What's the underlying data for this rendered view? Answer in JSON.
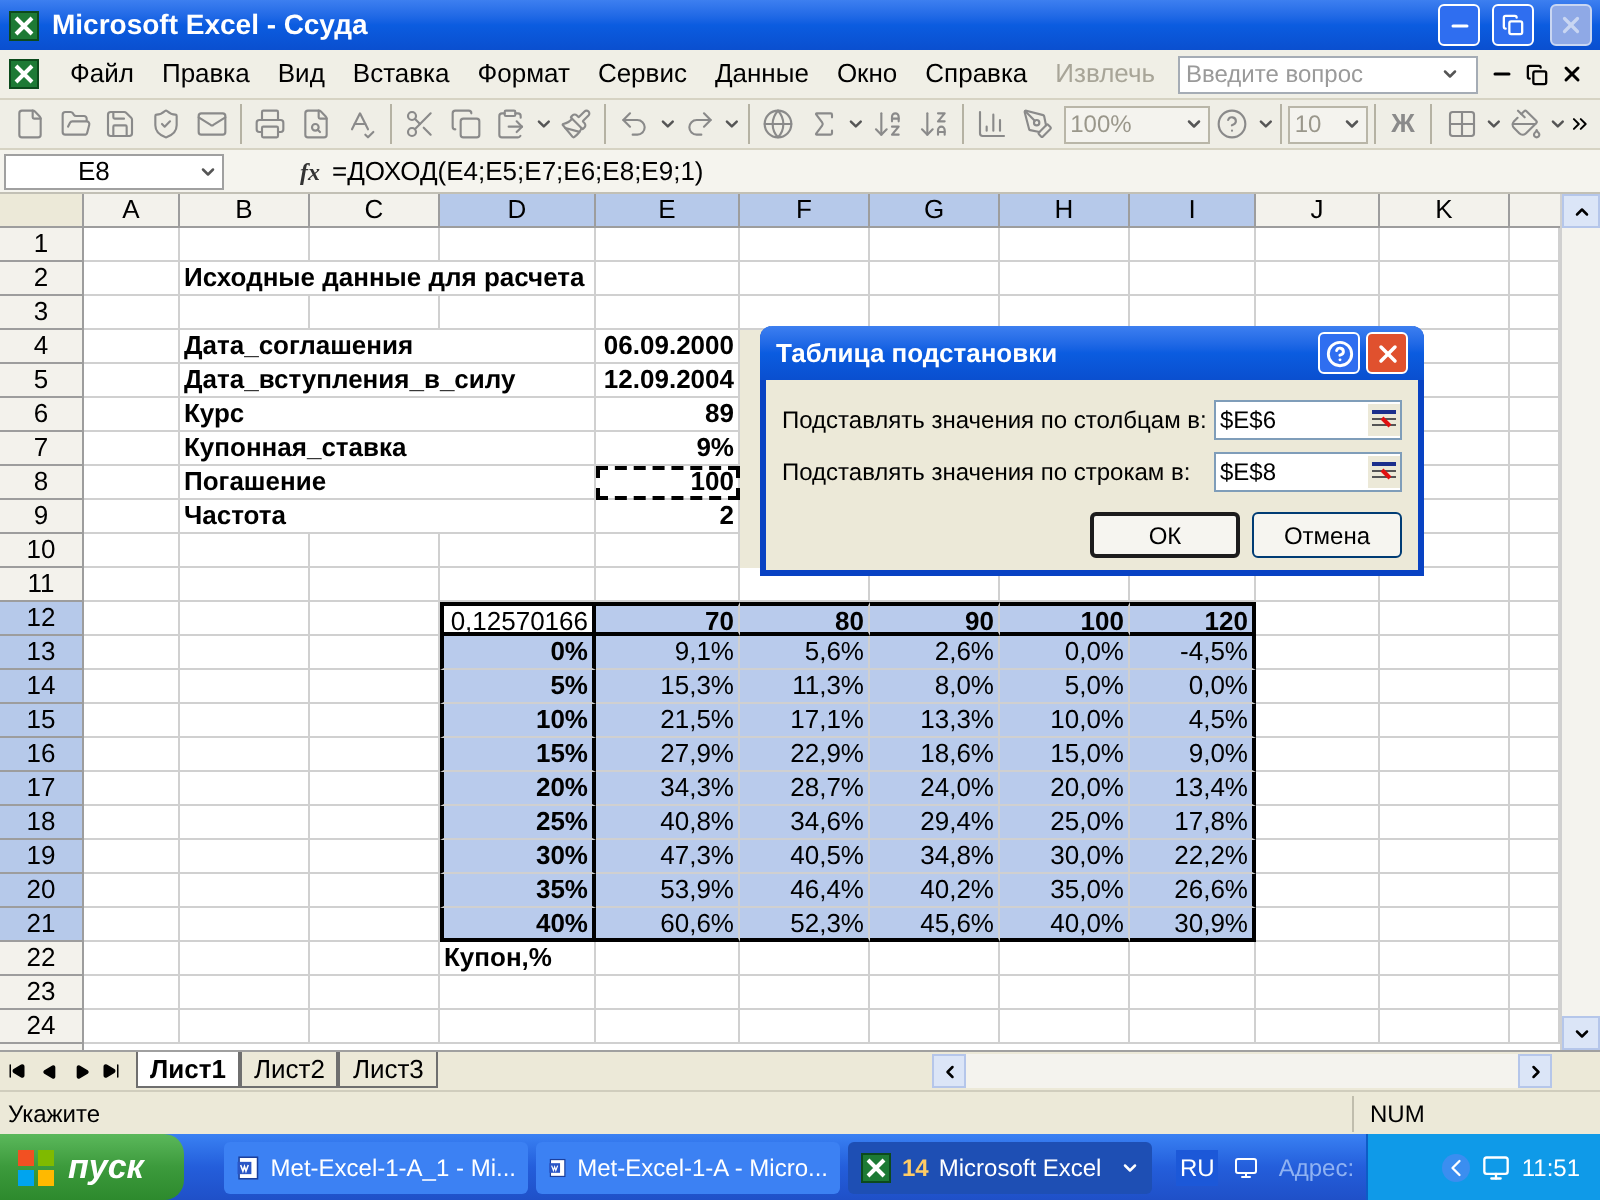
{
  "window": {
    "title": "Microsoft Excel - Ссуда"
  },
  "menu": {
    "items": [
      {
        "label": "Файл",
        "disabled": false
      },
      {
        "label": "Правка",
        "disabled": false
      },
      {
        "label": "Вид",
        "disabled": false
      },
      {
        "label": "Вставка",
        "disabled": false
      },
      {
        "label": "Формат",
        "disabled": false
      },
      {
        "label": "Сервис",
        "disabled": false
      },
      {
        "label": "Данные",
        "disabled": false
      },
      {
        "label": "Окно",
        "disabled": false
      },
      {
        "label": "Справка",
        "disabled": false
      },
      {
        "label": "Извлечь",
        "disabled": true
      }
    ],
    "help_search": {
      "placeholder": "Введите вопрос"
    }
  },
  "toolbar": {
    "zoom": "100%",
    "font_size": "10",
    "bold_button": "Ж"
  },
  "formula_bar": {
    "name_box": "E8",
    "function_button": "fx",
    "formula": "=ДОХОД(E4;E5;E7;E6;E8;E9;1)"
  },
  "sheet": {
    "columns": [
      {
        "label": "A",
        "selected": false
      },
      {
        "label": "B",
        "selected": false
      },
      {
        "label": "C",
        "selected": false
      },
      {
        "label": "D",
        "selected": true
      },
      {
        "label": "E",
        "selected": true
      },
      {
        "label": "F",
        "selected": true
      },
      {
        "label": "G",
        "selected": true
      },
      {
        "label": "H",
        "selected": true
      },
      {
        "label": "I",
        "selected": true
      },
      {
        "label": "J",
        "selected": false
      },
      {
        "label": "K",
        "selected": false
      }
    ],
    "rows": [
      {
        "label": "1",
        "selected": false
      },
      {
        "label": "2",
        "selected": false
      },
      {
        "label": "3",
        "selected": false
      },
      {
        "label": "4",
        "selected": false
      },
      {
        "label": "5",
        "selected": false
      },
      {
        "label": "6",
        "selected": false
      },
      {
        "label": "7",
        "selected": false
      },
      {
        "label": "8",
        "selected": false
      },
      {
        "label": "9",
        "selected": false
      },
      {
        "label": "10",
        "selected": false
      },
      {
        "label": "11",
        "selected": false
      },
      {
        "label": "12",
        "selected": true
      },
      {
        "label": "13",
        "selected": true
      },
      {
        "label": "14",
        "selected": true
      },
      {
        "label": "15",
        "selected": true
      },
      {
        "label": "16",
        "selected": true
      },
      {
        "label": "17",
        "selected": true
      },
      {
        "label": "18",
        "selected": true
      },
      {
        "label": "19",
        "selected": true
      },
      {
        "label": "20",
        "selected": true
      },
      {
        "label": "21",
        "selected": true
      },
      {
        "label": "22",
        "selected": false
      },
      {
        "label": "23",
        "selected": false
      },
      {
        "label": "24",
        "selected": false
      }
    ],
    "title_cell": "Исходные данные для расчета",
    "inputs": [
      {
        "label": "Дата_соглашения",
        "value": "06.09.2000",
        "marked": false
      },
      {
        "label": "Дата_вступления_в_силу",
        "value": "12.09.2004",
        "marked": false
      },
      {
        "label": "Курс",
        "value": "89",
        "marked": false
      },
      {
        "label": "Купонная_ставка",
        "value": "9%",
        "marked": false
      },
      {
        "label": "Погашение",
        "value": "100",
        "marked": true
      },
      {
        "label": "Частота",
        "value": "2",
        "marked": false
      }
    ],
    "data_table": {
      "selected": true,
      "corner": "0,12570166",
      "column_values": [
        "70",
        "80",
        "90",
        "100",
        "120"
      ],
      "rows": [
        {
          "label": "0%",
          "values": [
            "9,1%",
            "5,6%",
            "2,6%",
            "0,0%",
            "-4,5%"
          ]
        },
        {
          "label": "5%",
          "values": [
            "15,3%",
            "11,3%",
            "8,0%",
            "5,0%",
            "0,0%"
          ]
        },
        {
          "label": "10%",
          "values": [
            "21,5%",
            "17,1%",
            "13,3%",
            "10,0%",
            "4,5%"
          ]
        },
        {
          "label": "15%",
          "values": [
            "27,9%",
            "22,9%",
            "18,6%",
            "15,0%",
            "9,0%"
          ]
        },
        {
          "label": "20%",
          "values": [
            "34,3%",
            "28,7%",
            "24,0%",
            "20,0%",
            "13,4%"
          ]
        },
        {
          "label": "25%",
          "values": [
            "40,8%",
            "34,6%",
            "29,4%",
            "25,0%",
            "17,8%"
          ]
        },
        {
          "label": "30%",
          "values": [
            "47,3%",
            "40,5%",
            "34,8%",
            "30,0%",
            "22,2%"
          ]
        },
        {
          "label": "35%",
          "values": [
            "53,9%",
            "46,4%",
            "40,2%",
            "35,0%",
            "26,6%"
          ]
        },
        {
          "label": "40%",
          "values": [
            "60,6%",
            "52,3%",
            "45,6%",
            "40,0%",
            "30,9%"
          ]
        }
      ]
    },
    "footer_cell": "Купон,%"
  },
  "dialog": {
    "title": "Таблица подстановки",
    "fields": [
      {
        "label": "Подставлять значения по столбцам в:",
        "value": "$E$6"
      },
      {
        "label": "Подставлять значения по строкам в:",
        "value": "$E$8"
      }
    ],
    "buttons": [
      {
        "label": "ОК",
        "default": true
      },
      {
        "label": "Отмена",
        "default": false
      }
    ]
  },
  "sheet_tabs": [
    {
      "label": "Лист1",
      "selected": true
    },
    {
      "label": "Лист2",
      "selected": false
    },
    {
      "label": "Лист3",
      "selected": false
    }
  ],
  "status_bar": {
    "message": "Укажите",
    "indicator": "NUM"
  },
  "taskbar": {
    "start": "пуск",
    "tasks": [
      {
        "kind": "word",
        "label": "Met-Excel-1-A_1 - Mi...",
        "selected": false
      },
      {
        "kind": "word",
        "label": "Met-Excel-1-A - Micro...",
        "selected": false
      },
      {
        "kind": "excel",
        "count": "14",
        "label": "Microsoft Excel",
        "selected": true
      }
    ],
    "language": "RU",
    "address_label": "Адрес:",
    "clock": "11:51"
  }
}
